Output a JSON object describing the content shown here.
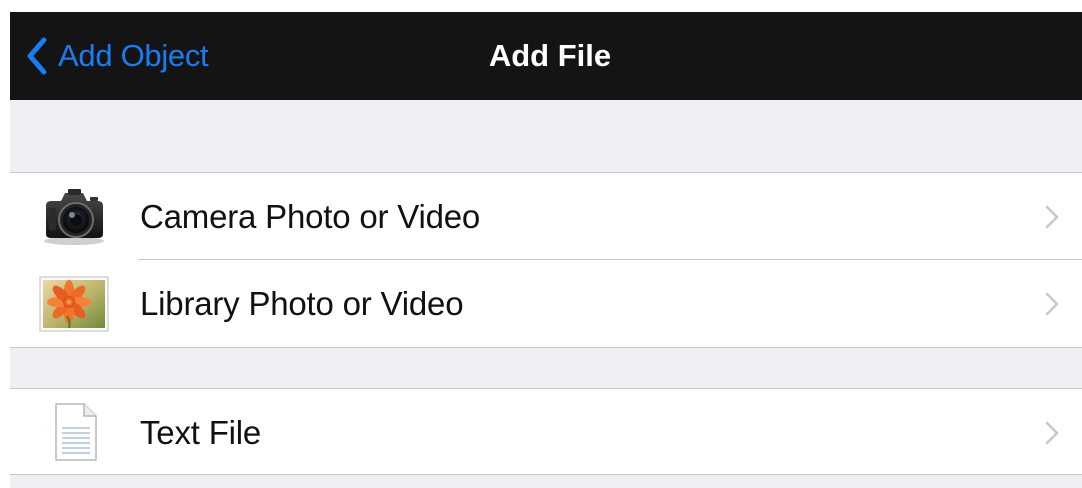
{
  "navbar": {
    "back_label": "Add Object",
    "back_icon": "chevron-left-icon",
    "title": "Add File"
  },
  "groups": [
    {
      "rows": [
        {
          "label": "Camera Photo or Video",
          "icon": "camera-icon"
        },
        {
          "label": "Library Photo or Video",
          "icon": "photo-library-icon"
        }
      ]
    },
    {
      "rows": [
        {
          "label": "Text File",
          "icon": "text-file-icon"
        }
      ]
    }
  ],
  "colors": {
    "navbar_bg": "#141414",
    "accent": "#1a7cf0",
    "group_bg": "#efeff4",
    "separator": "#c8c7cc",
    "chevron": "#c7c7cc"
  }
}
